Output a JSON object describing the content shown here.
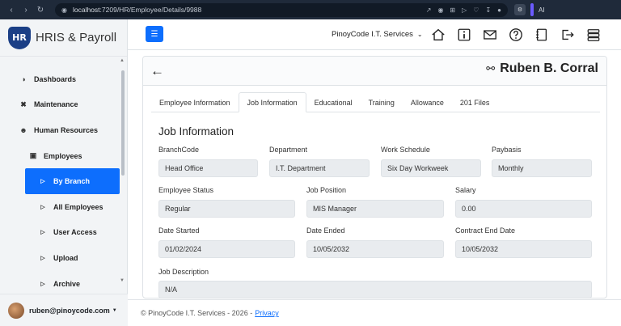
{
  "browser": {
    "url_host": "localhost",
    "url_path": ":7209/HR/Employee/Details/9988",
    "ext_label": "AI"
  },
  "brand": {
    "logo_text": "HR",
    "name": "HRIS & Payroll"
  },
  "sidebar": {
    "items": [
      {
        "label": "Dashboards",
        "icon": "dashboard-icon"
      },
      {
        "label": "Maintenance",
        "icon": "tools-icon"
      },
      {
        "label": "Human Resources",
        "icon": "people-icon"
      },
      {
        "label": "Employees",
        "icon": "id-badge-icon"
      },
      {
        "label": "By Branch",
        "icon": "play-icon",
        "active": true
      },
      {
        "label": "All Employees",
        "icon": "play-icon"
      },
      {
        "label": "User Access",
        "icon": "play-icon"
      },
      {
        "label": "Upload",
        "icon": "play-icon"
      },
      {
        "label": "Archive",
        "icon": "play-icon"
      }
    ],
    "user": "ruben@pinoycode.com"
  },
  "topbar": {
    "company": "PinoyCode I.T. Services"
  },
  "employee": {
    "name": "Ruben B. Corral"
  },
  "tabs": [
    "Employee Information",
    "Job Information",
    "Educational",
    "Training",
    "Allowance",
    "201 Files"
  ],
  "job": {
    "title": "Job Information",
    "branch_label": "BranchCode",
    "branch": "Head Office",
    "dept_label": "Department",
    "dept": "I.T. Department",
    "schedule_label": "Work Schedule",
    "schedule": "Six Day Workweek",
    "paybasis_label": "Paybasis",
    "paybasis": "Monthly",
    "status_label": "Employee Status",
    "status": "Regular",
    "position_label": "Job Position",
    "position": "MIS Manager",
    "salary_label": "Salary",
    "salary": "0.00",
    "started_label": "Date Started",
    "started": "01/02/2024",
    "ended_label": "Date Ended",
    "ended": "10/05/2032",
    "contract_label": "Contract End Date",
    "contract": "10/05/2032",
    "desc_label": "Job Description",
    "desc": "N/A"
  },
  "footer": {
    "text": "© PinoyCode I.T. Services - 2026 -",
    "link": "Privacy"
  }
}
